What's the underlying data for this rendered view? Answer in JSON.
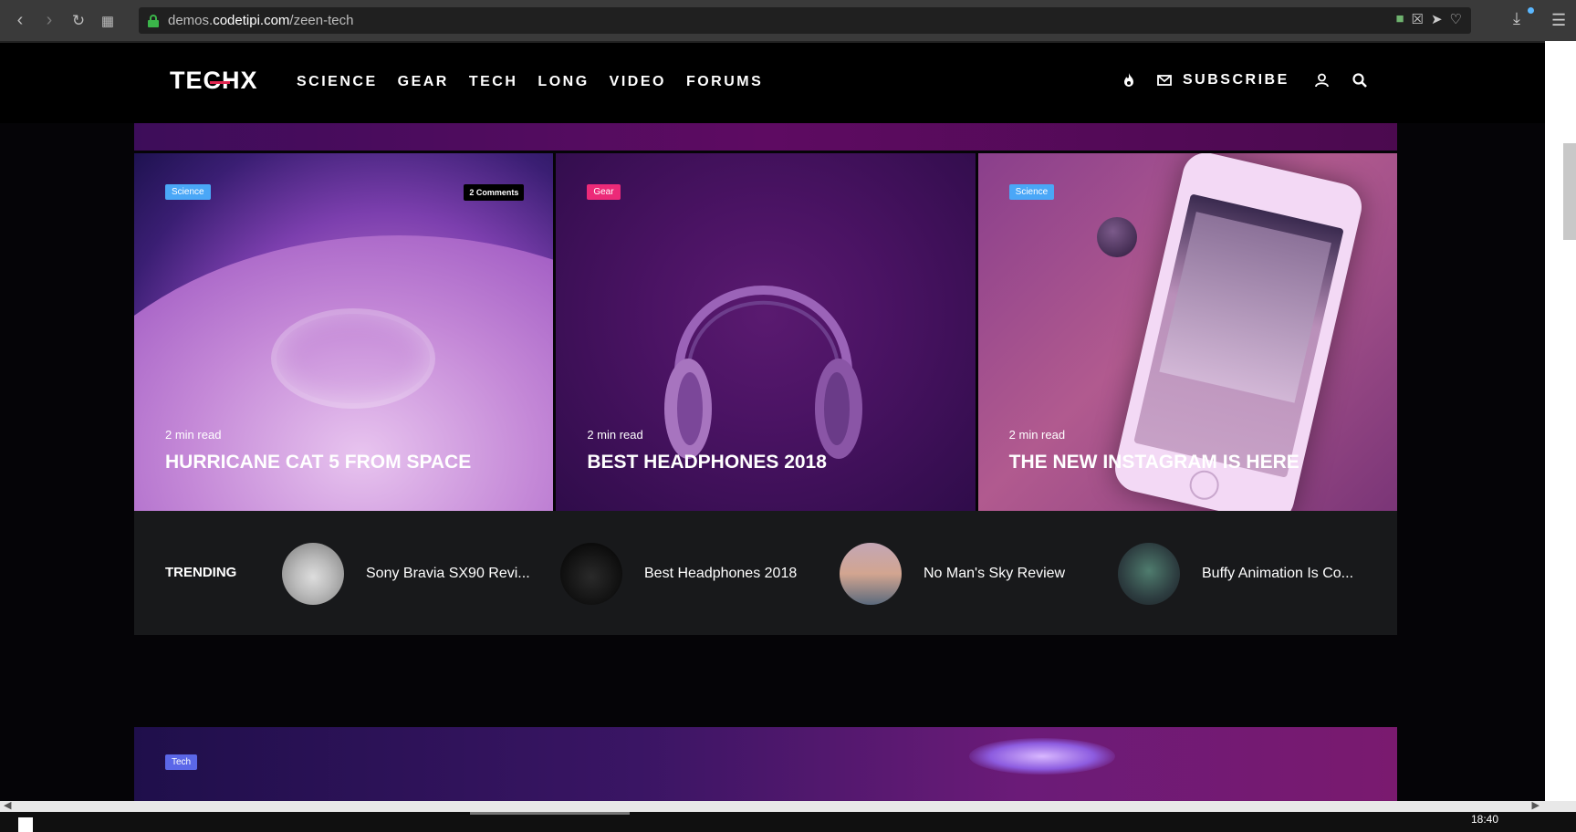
{
  "browser": {
    "url_prefix": "demos.",
    "url_domain": "codetipi.com",
    "url_path": "/zeen-tech"
  },
  "header": {
    "logo": "TECHX",
    "nav": [
      "SCIENCE",
      "GEAR",
      "TECH",
      "LONG",
      "VIDEO",
      "FORUMS"
    ],
    "subscribe_label": "SUBSCRIBE"
  },
  "cards": [
    {
      "category": "Science",
      "comments": "2 Comments",
      "readtime": "2 min read",
      "title": "HURRICANE CAT 5 FROM SPACE"
    },
    {
      "category": "Gear",
      "readtime": "2 min read",
      "title": "BEST HEADPHONES 2018"
    },
    {
      "category": "Science",
      "readtime": "2 min read",
      "title": "THE NEW INSTAGRAM IS HERE"
    }
  ],
  "trending": {
    "label": "TRENDING",
    "items": [
      {
        "title": "Sony Bravia SX90 Revi..."
      },
      {
        "title": "Best Headphones 2018"
      },
      {
        "title": "No Man's Sky Review"
      },
      {
        "title": "Buffy Animation Is Co..."
      }
    ]
  },
  "bottom_card": {
    "category": "Tech"
  },
  "taskbar": {
    "clock": "18:40"
  },
  "colors": {
    "science_tag": "#4aa7f7",
    "gear_tag": "#ec2a78",
    "tech_tag": "#5b67e8",
    "logo_accent": "#e1254f"
  },
  "icons": {
    "back": "back-arrow-icon",
    "forward": "forward-arrow-icon",
    "reload": "reload-icon",
    "tabs": "grid-icon",
    "lock": "lock-icon",
    "fire": "fire-icon",
    "mail": "mail-icon",
    "user": "user-icon",
    "search": "search-icon"
  }
}
